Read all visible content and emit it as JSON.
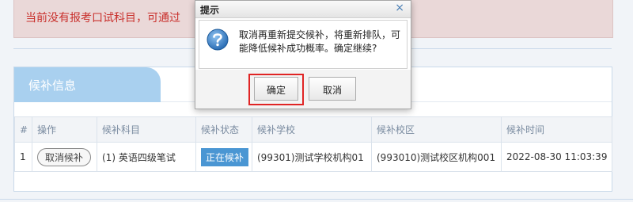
{
  "notice": {
    "text": "当前没有报考口试科目，可通过"
  },
  "panel": {
    "title": "候补信息",
    "table": {
      "headers": [
        "#",
        "操作",
        "候补科目",
        "候补状态",
        "候补学校",
        "候补校区",
        "候补时间"
      ],
      "rows": [
        {
          "index": "1",
          "action": "取消候补",
          "subject": "(1) 英语四级笔试",
          "status": "正在候补",
          "school": "(99301)测试学校机构01",
          "campus": "(993010)测试校区机构001",
          "time": "2022-08-30 11:03:39"
        }
      ]
    }
  },
  "dialog": {
    "title": "提示",
    "close": "×",
    "icon": "question-icon",
    "message": "取消再重新提交候补，将重新排队，可能降低候补成功概率。确定继续?",
    "confirm_label": "确定",
    "cancel_label": "取消"
  },
  "colors": {
    "notice_bg": "#ead8d8",
    "notice_text": "#c9302c",
    "tab_bg": "#a9d0ef",
    "status_bg": "#4a96d3",
    "highlight": "#e02424"
  }
}
